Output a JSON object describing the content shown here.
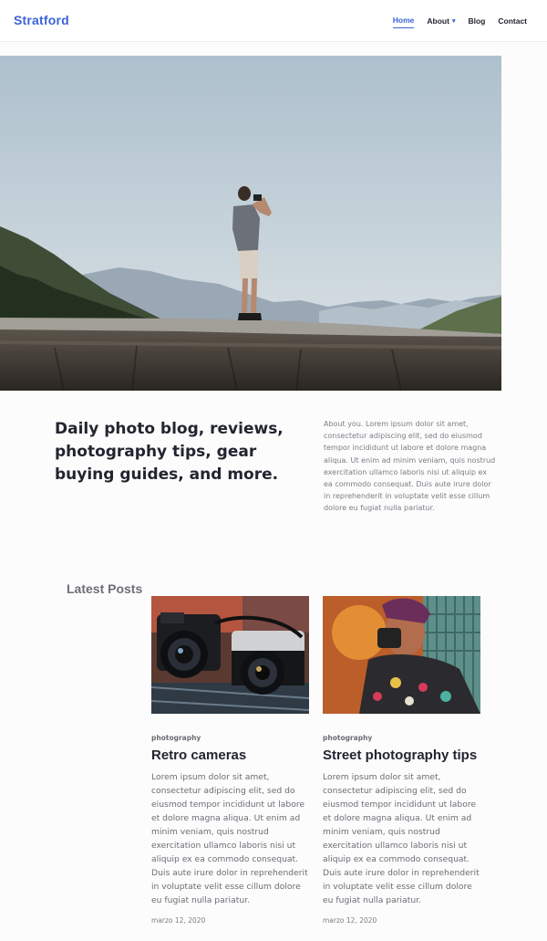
{
  "site": {
    "logo": "Stratford"
  },
  "nav": {
    "items": [
      {
        "label": "Home",
        "active": true
      },
      {
        "label": "About",
        "dropdown": true
      },
      {
        "label": "Blog"
      },
      {
        "label": "Contact"
      }
    ],
    "caret": "▾"
  },
  "intro": {
    "title": "Daily photo blog, reviews, photography tips, gear buying guides, and more.",
    "text": "About you. Lorem ipsum dolor sit amet, consectetur adipiscing elit, sed do eiusmod tempor incididunt ut labore et dolore magna aliqua. Ut enim ad minim veniam, quis nostrud exercitation ullamco laboris nisi ut aliquip ex ea commodo consequat. Duis aute irure dolor in reprehenderit in voluptate velit esse cillum dolore eu fugiat nulla pariatur."
  },
  "latest": {
    "heading": "Latest Posts",
    "posts": [
      {
        "category": "photography",
        "title": "Retro cameras",
        "excerpt": "Lorem ipsum dolor sit amet, consectetur adipiscing elit, sed do eiusmod tempor incididunt ut labore et dolore magna aliqua. Ut enim ad minim veniam, quis nostrud exercitation ullamco laboris nisi ut aliquip ex ea commodo consequat. Duis aute irure dolor in reprehenderit in voluptate velit esse cillum dolore eu fugiat nulla pariatur.",
        "date": "marzo 12, 2020"
      },
      {
        "category": "photography",
        "title": "Street photography tips",
        "excerpt": "Lorem ipsum dolor sit amet, consectetur adipiscing elit, sed do eiusmod tempor incididunt ut labore et dolore magna aliqua. Ut enim ad minim veniam, quis nostrud exercitation ullamco laboris nisi ut aliquip ex ea commodo consequat. Duis aute irure dolor in reprehenderit in voluptate velit esse cillum dolore eu fugiat nulla pariatur.",
        "date": "marzo 12, 2020"
      }
    ]
  },
  "colors": {
    "accent": "#3b63d6",
    "heading": "#222531",
    "muted": "#6b6d75",
    "background": "#fdfcfc"
  }
}
